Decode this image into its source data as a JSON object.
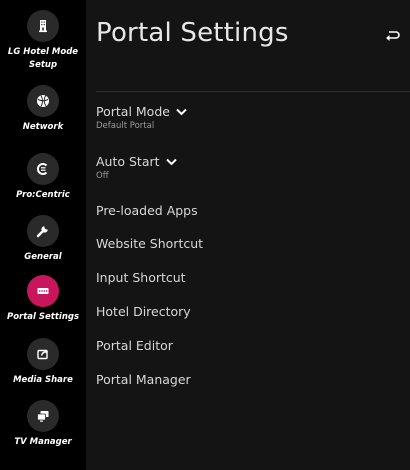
{
  "sidebar": {
    "items": [
      {
        "label": "LG Hotel Mode\nSetup",
        "icon": "hotel-icon",
        "active": false
      },
      {
        "label": "Network",
        "icon": "network-icon",
        "active": false
      },
      {
        "label": "Pro:Centric",
        "icon": "procentric-icon",
        "active": false
      },
      {
        "label": "General",
        "icon": "wrench-icon",
        "active": false
      },
      {
        "label": "Portal Settings",
        "icon": "portal-icon",
        "active": true
      },
      {
        "label": "Media Share",
        "icon": "media-share-icon",
        "active": false
      },
      {
        "label": "TV Manager",
        "icon": "tv-manager-icon",
        "active": false
      }
    ]
  },
  "main": {
    "title": "Portal Settings",
    "back_icon": "back-arrow-icon",
    "menu": [
      {
        "label": "Portal Mode",
        "sub": "Default Portal",
        "dropdown": true
      },
      {
        "label": "Auto Start",
        "sub": "Off",
        "dropdown": true
      },
      {
        "label": "Pre-loaded Apps"
      },
      {
        "label": "Website Shortcut"
      },
      {
        "label": "Input Shortcut"
      },
      {
        "label": "Hotel Directory"
      },
      {
        "label": "Portal Editor"
      },
      {
        "label": "Portal Manager"
      }
    ]
  },
  "colors": {
    "accent": "#c8155b",
    "background": "#141414",
    "sidebar": "#000000"
  }
}
